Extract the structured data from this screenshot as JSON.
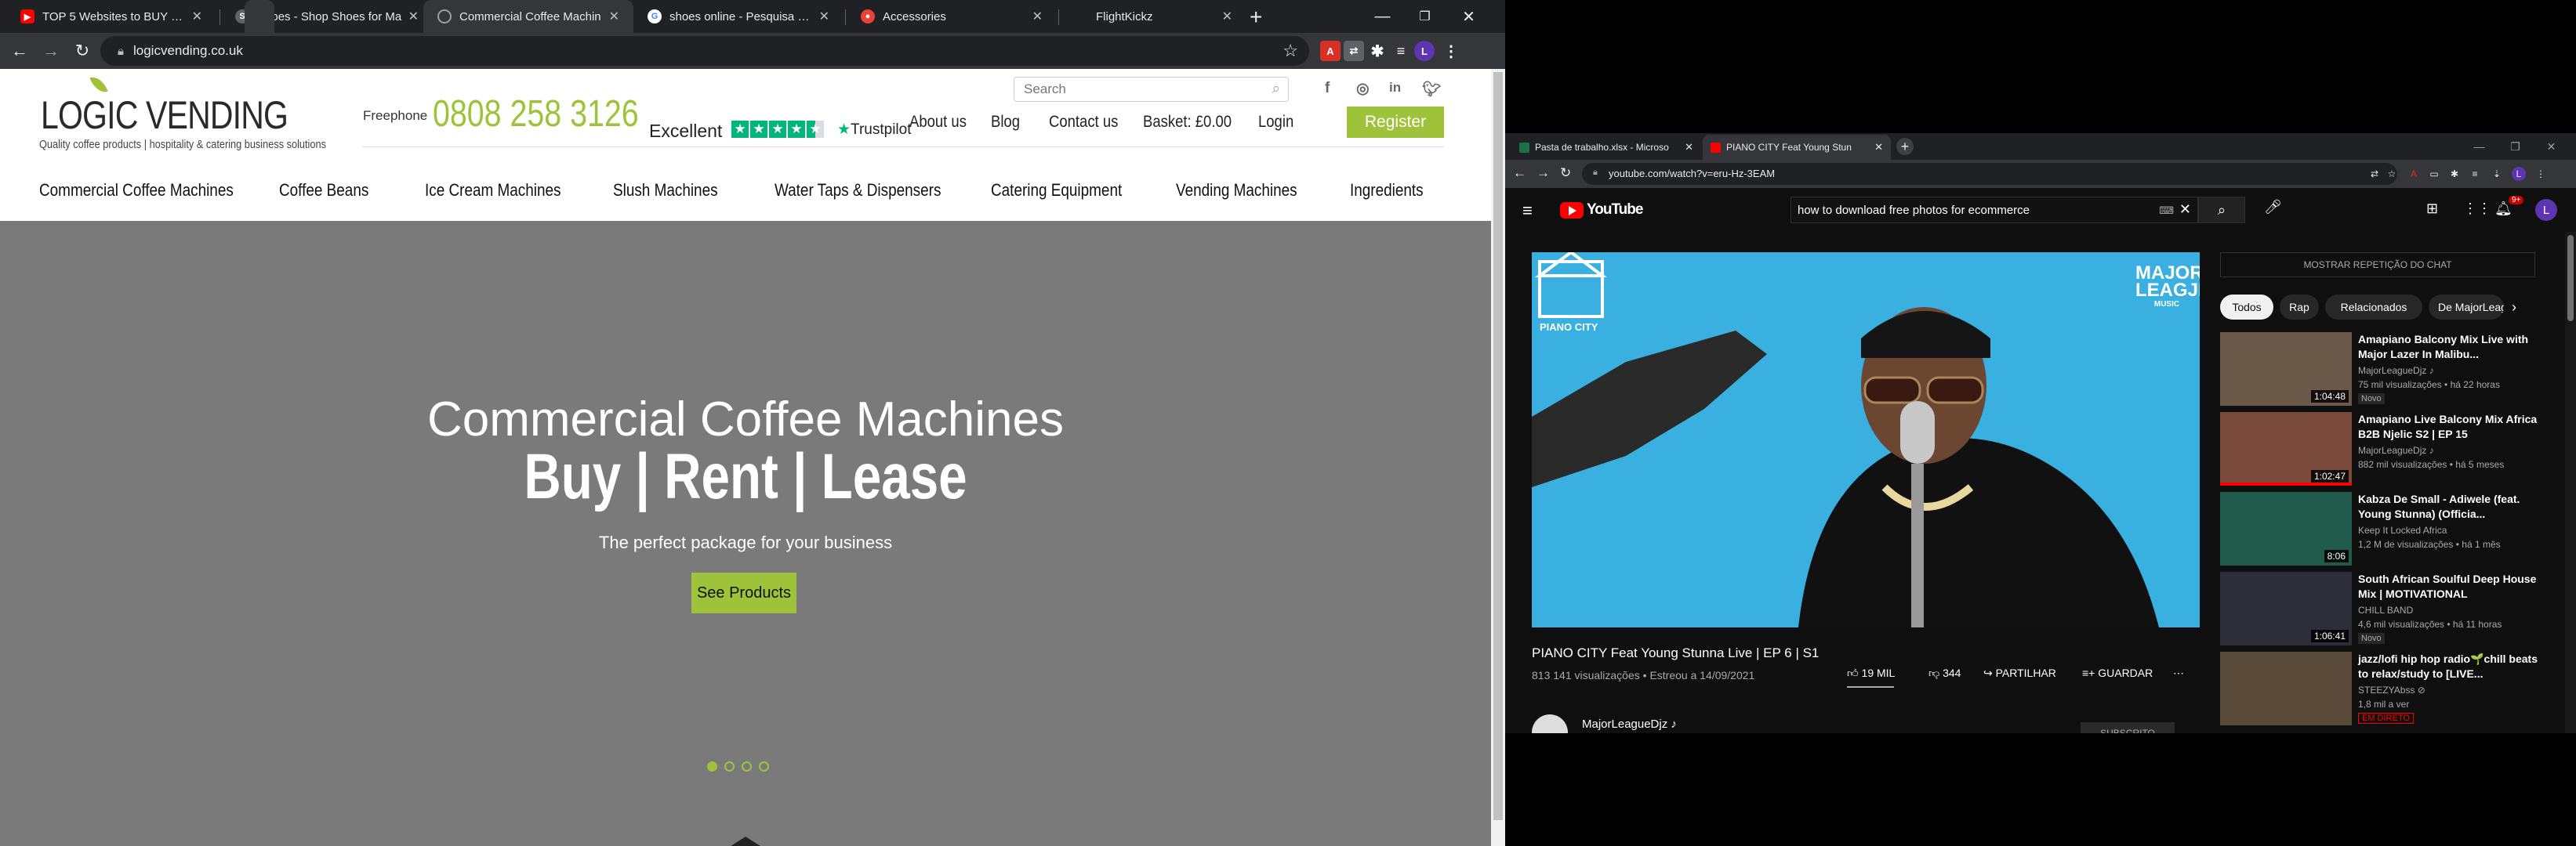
{
  "left_browser": {
    "tabs": [
      {
        "title": "TOP 5 Websites to BUY Sne",
        "icon": "youtube-icon",
        "color": "#ff0000"
      },
      {
        "title": "Shoes - Shop Shoes for Ma",
        "icon": "s-icon",
        "color": "#5f6368"
      },
      {
        "title": "Commercial Coffee Machin",
        "icon": "globe-icon",
        "color": "#9aa0a6",
        "active": true
      },
      {
        "title": "shoes online - Pesquisa Go",
        "icon": "google-icon",
        "color": "#4285f4"
      },
      {
        "title": "Accessories",
        "icon": "accessories-icon",
        "color": "#ea4335"
      },
      {
        "title": "FlightKickz",
        "icon": "blank-icon",
        "color": "#202124"
      }
    ],
    "url": "logicvending.co.uk"
  },
  "site": {
    "logo": "LOGIC VENDING",
    "tagline": "Quality coffee products | hospitality & catering business solutions",
    "freephone_label": "Freephone",
    "freephone_number": "0808 258 3126",
    "trustpilot_label": "Excellent",
    "trustpilot_brand": "Trustpilot",
    "search_placeholder": "Search",
    "top_nav": [
      "About us",
      "Blog",
      "Contact us",
      "Basket: £0.00",
      "Login"
    ],
    "register": "Register",
    "category_nav": [
      "Commercial Coffee Machines",
      "Coffee Beans",
      "Ice Cream Machines",
      "Slush Machines",
      "Water Taps & Dispensers",
      "Catering Equipment",
      "Vending Machines",
      "Ingredients"
    ],
    "hero": {
      "subtitle": "Commercial Coffee Machines",
      "headline": "Buy | Rent | Lease",
      "tagline": "The perfect package for your business",
      "button": "See Products",
      "slide_count": 4,
      "active_slide": 1
    },
    "colors": {
      "brand_green": "#9ec33b",
      "hero_bg": "#7a7a7a"
    }
  },
  "right_browser": {
    "tabs": [
      {
        "title": "Pasta de trabalho.xlsx - Microso",
        "icon": "excel-icon",
        "color": "#1e7145"
      },
      {
        "title": "PIANO CITY Feat Young Stun",
        "icon": "youtube-icon",
        "color": "#ff0000",
        "active": true
      }
    ],
    "url": "youtube.com/watch?v=eru-Hz-3EAM",
    "youtube": {
      "logo": "YouTube",
      "search_query": "how to download free photos for ecommerce",
      "notifications": "9+",
      "avatar": "L",
      "video": {
        "overlay_left": "PIANO CITY",
        "overlay_right_1": "MAJOR",
        "overlay_right_2": "LEAGJE",
        "overlay_right_3": "MUSIC",
        "title": "PIANO CITY Feat Young Stunna Live | EP 6 | S1",
        "meta": "813 141 visualizações • Estreou a 14/09/2021",
        "likes": "19 MIL",
        "dislikes": "344",
        "share": "PARTILHAR",
        "save": "GUARDAR",
        "channel": "MajorLeagueDjz ♪",
        "subscribe": "SUBSCRITO"
      },
      "chat_replay": "MOSTRAR REPETIÇÃO DO CHAT",
      "chips": [
        "Todos",
        "Rap",
        "Relacionados",
        "De MajorLeag"
      ],
      "recommendations": [
        {
          "title": "Amapiano Balcony Mix Live with Major Lazer In Malibu...",
          "channel": "MajorLeagueDjz ♪",
          "views": "75 mil visualizações • há 22 horas",
          "badge": "Novo",
          "duration": "1:04:48",
          "thumb": "#6b5a4a"
        },
        {
          "title": "Amapiano Live Balcony Mix Africa B2B Njelic S2 | EP 15",
          "channel": "MajorLeagueDjz ♪",
          "views": "882 mil visualizações • há 5 meses",
          "badge": "",
          "duration": "1:02:47",
          "thumb": "#7a4a3a"
        },
        {
          "title": "Kabza De Small - Adiwele (feat. Young Stunna) (Officia...",
          "channel": "Keep It Locked Africa",
          "views": "1,2 M de visualizações • há 1 mês",
          "badge": "",
          "duration": "8:06",
          "thumb": "#1f5a4a"
        },
        {
          "title": "South African Soulful Deep House Mix | MOTIVATIONAL",
          "channel": "CHILL BAND",
          "views": "4,6 mil visualizações • há 11 horas",
          "badge": "Novo",
          "duration": "1:06:41",
          "thumb": "#2e2e3a"
        },
        {
          "title": "jazz/lofi hip hop radio🌱chill beats to relax/study to [LIVE...",
          "channel": "STEEZYAbss ⊘",
          "views": "1,8 mil a ver",
          "badge": "EM DIRETO",
          "duration": "",
          "thumb": "#5a4a3a"
        }
      ]
    }
  }
}
